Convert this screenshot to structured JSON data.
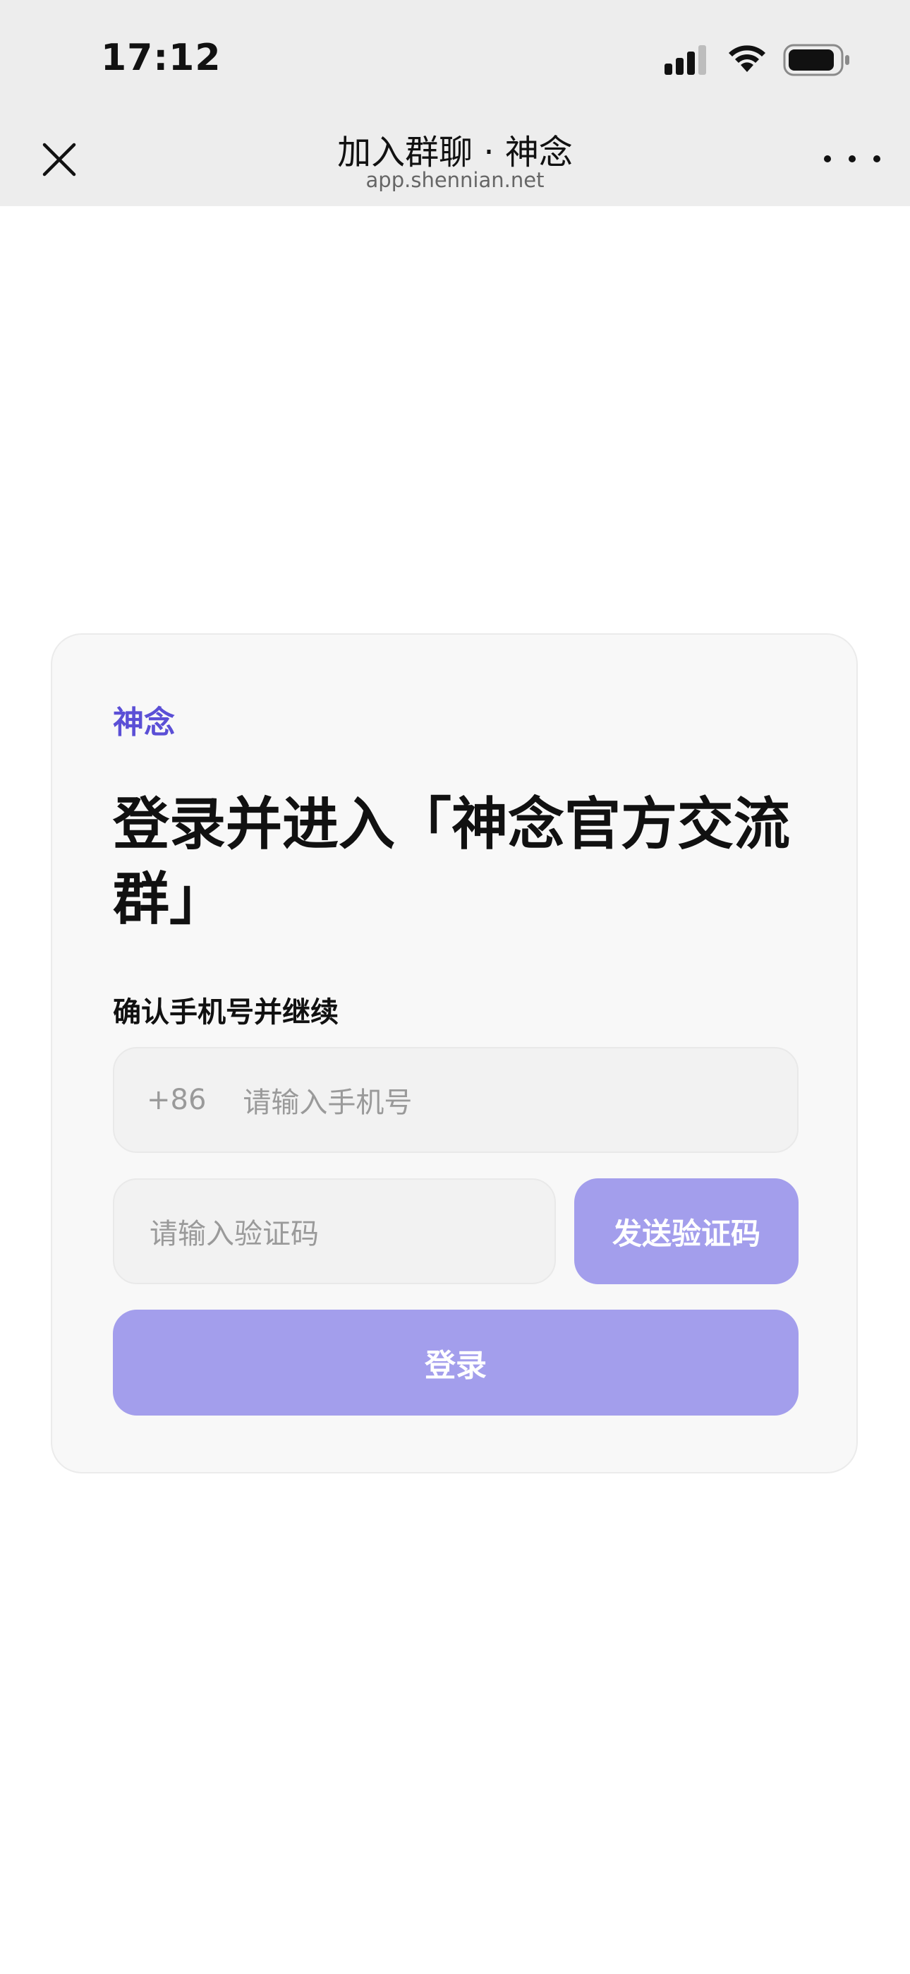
{
  "status_bar": {
    "time": "17:12"
  },
  "nav": {
    "title": "加入群聊 · 神念",
    "url": "app.shennian.net"
  },
  "card": {
    "brand": "神念",
    "headline": "登录并进入「神念官方交流群」",
    "subtitle": "确认手机号并继续",
    "phone": {
      "country_code": "+86",
      "placeholder": "请输入手机号"
    },
    "code": {
      "placeholder": "请输入验证码"
    },
    "send_code_label": "发送验证码",
    "login_label": "登录"
  },
  "colors": {
    "accent": "#5b4fd6",
    "button_disabled": "#a39eec",
    "topbar_bg": "#ededed"
  },
  "icons": [
    "signal-icon",
    "wifi-icon",
    "battery-icon",
    "close-icon",
    "more-icon"
  ]
}
